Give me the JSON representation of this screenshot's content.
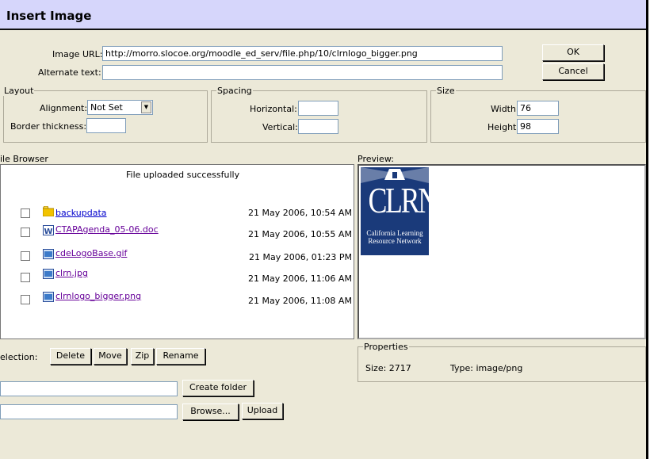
{
  "dialog": {
    "title": "Insert Image"
  },
  "form": {
    "image_url_label": "Image URL:",
    "image_url_value": "http://morro.slocoe.org/moodle_ed_serv/file.php/10/clrnlogo_bigger.png",
    "alt_text_label": "Alternate text:",
    "alt_text_value": ""
  },
  "buttons": {
    "ok": "OK",
    "cancel": "Cancel"
  },
  "layout": {
    "legend": "Layout",
    "alignment_label": "Alignment:",
    "alignment_value": "Not Set",
    "border_label": "Border thickness:",
    "border_value": ""
  },
  "spacing": {
    "legend": "Spacing",
    "horizontal_label": "Horizontal:",
    "horizontal_value": "",
    "vertical_label": "Vertical:",
    "vertical_value": ""
  },
  "size": {
    "legend": "Size",
    "width_label": "Width:",
    "width_value": "76",
    "height_label": "Height:",
    "height_value": "98"
  },
  "file_browser": {
    "label": "ile Browser",
    "status": "File uploaded successfully",
    "files": [
      {
        "name": "backupdata",
        "type": "folder-icon",
        "date": "21 May 2006, 10:54 AM"
      },
      {
        "name": "CTAPAgenda_05-06.doc",
        "type": "word-doc-icon",
        "date": "21 May 2006, 10:55 AM"
      },
      {
        "name": "cdeLogoBase.gif",
        "type": "image-file-icon",
        "date": "21 May 2006, 01:23 PM"
      },
      {
        "name": "clrn.jpg",
        "type": "image-file-icon",
        "date": "21 May 2006, 11:06 AM"
      },
      {
        "name": "clrnlogo_bigger.png",
        "type": "image-file-icon",
        "date": "21 May 2006, 11:08 AM"
      }
    ]
  },
  "preview": {
    "label": "Preview:",
    "logo_big": "CLRN",
    "logo_line1": "California Learning",
    "logo_line2": "Resource Network"
  },
  "properties": {
    "legend": "Properties",
    "size_text": "Size: 2717",
    "type_text": "Type: image/png"
  },
  "selection": {
    "label": "election:",
    "delete": "Delete",
    "move": "Move",
    "zip": "Zip",
    "rename": "Rename"
  },
  "folder": {
    "value": "",
    "create_label": "Create folder"
  },
  "upload": {
    "value": "",
    "browse_label": "Browse...",
    "upload_label": "Upload"
  },
  "colors": {
    "title_bg": "#d6d6fb",
    "dialog_bg": "#ece9d8",
    "link": "#0000cc",
    "logo_bg": "#1a3a7a"
  }
}
